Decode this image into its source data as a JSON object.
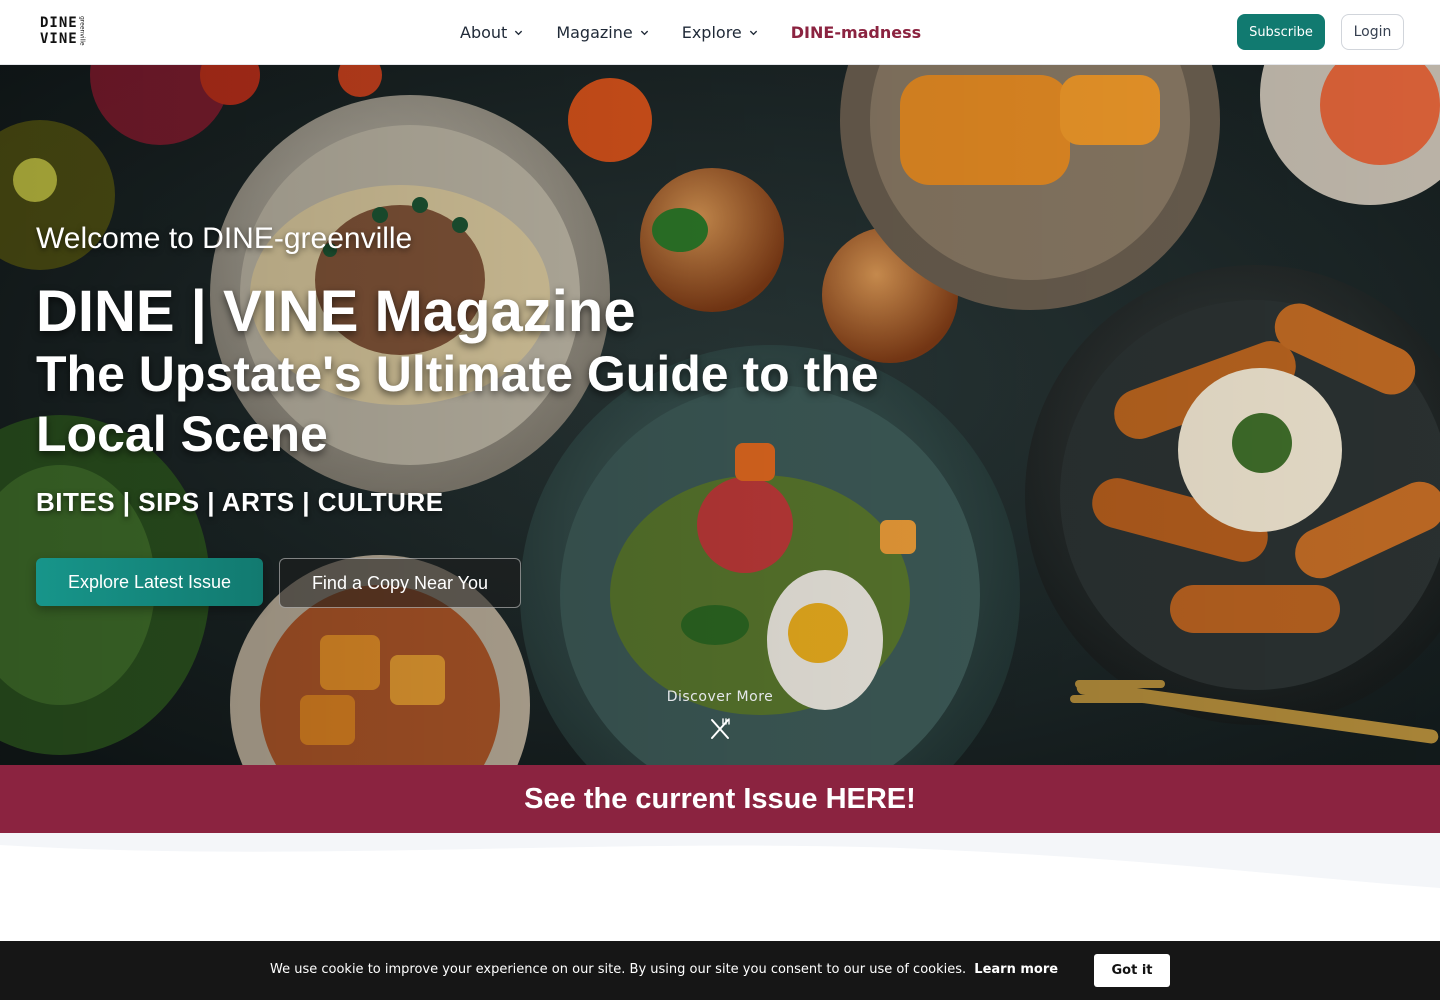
{
  "nav": {
    "logo": {
      "line1": "DINE",
      "line2": "VINE",
      "side": "greenville"
    },
    "menu": [
      {
        "label": "About",
        "has_dropdown": true
      },
      {
        "label": "Magazine",
        "has_dropdown": true
      },
      {
        "label": "Explore",
        "has_dropdown": true
      },
      {
        "label": "DINE-madness",
        "has_dropdown": false
      }
    ],
    "subscribe_label": "Subscribe",
    "login_label": "Login"
  },
  "hero": {
    "welcome": "Welcome to DINE-greenville",
    "title": "DINE | VINE Magazine",
    "subtitle": "The Upstate's Ultimate Guide to the Local Scene",
    "tagline": "BITES | SIPS | ARTS | CULTURE",
    "primary_button": "Explore Latest Issue",
    "secondary_button": "Find a Copy Near You",
    "discover_label": "Discover More",
    "discover_icon": "utensils-crossed-icon",
    "background": "food-spread-photo"
  },
  "banner": {
    "text": "See the current Issue HERE!"
  },
  "cookie": {
    "message": "We use cookie to improve your experience on our site. By using our site you consent to our use of cookies.",
    "learn_more": "Learn more",
    "button": "Got it"
  },
  "colors": {
    "brand_teal": "#117a70",
    "brand_wine": "#8b2340",
    "cookie_bar": "#161616"
  }
}
